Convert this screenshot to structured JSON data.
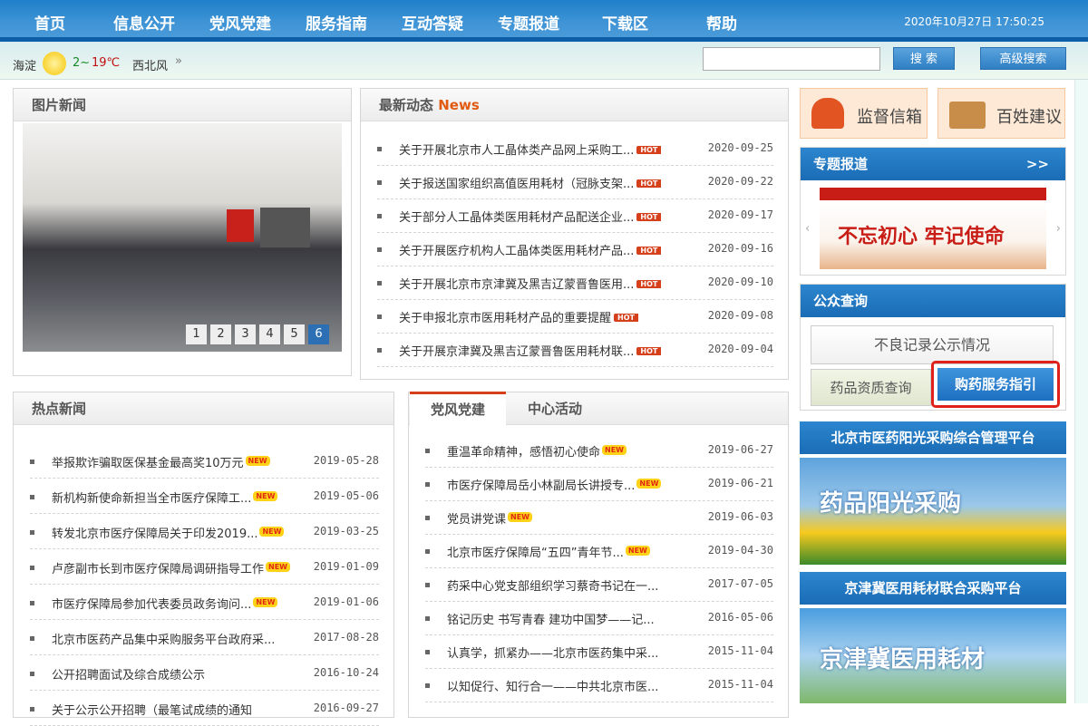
{
  "nav": {
    "items": [
      "首页",
      "信息公开",
      "党风党建",
      "服务指南",
      "互动答疑",
      "专题报道",
      "下载区",
      "帮助"
    ],
    "clock": "2020年10月27日 17:50:25"
  },
  "weather": {
    "city": "海淀",
    "temp_low": "2~",
    "temp_high": "19℃",
    "wind": "西北风",
    "more": "»"
  },
  "search": {
    "value": "",
    "button": "搜 索",
    "advanced": "高级搜索"
  },
  "photo_news": {
    "title": "图片新闻",
    "pages": [
      "1",
      "2",
      "3",
      "4",
      "5",
      "6"
    ],
    "active_page": 6
  },
  "latest": {
    "title": "最新动态",
    "title_en": "News",
    "badge": "HOT",
    "items": [
      {
        "t": "关于开展北京市人工晶体类产品网上采购工...",
        "d": "2020-09-25"
      },
      {
        "t": "关于报送国家组织高值医用耗材（冠脉支架...",
        "d": "2020-09-22"
      },
      {
        "t": "关于部分人工晶体类医用耗材产品配送企业...",
        "d": "2020-09-17"
      },
      {
        "t": "关于开展医疗机构人工晶体类医用耗材产品...",
        "d": "2020-09-16"
      },
      {
        "t": "关于开展北京市京津冀及黑吉辽蒙晋鲁医用...",
        "d": "2020-09-10"
      },
      {
        "t": "关于申报北京市医用耗材产品的重要提醒",
        "d": "2020-09-08"
      },
      {
        "t": "关于开展京津冀及黑吉辽蒙晋鲁医用耗材联...",
        "d": "2020-09-04"
      }
    ]
  },
  "hot_news": {
    "title": "热点新闻",
    "badge": "NEW",
    "items": [
      {
        "t": "举报欺诈骗取医保基金最高奖10万元",
        "d": "2019-05-28"
      },
      {
        "t": "新机构新使命新担当全市医疗保障工...",
        "d": "2019-05-06"
      },
      {
        "t": "转发北京市医疗保障局关于印发2019...",
        "d": "2019-03-25"
      },
      {
        "t": "卢彦副市长到市医疗保障局调研指导工作",
        "d": "2019-01-09"
      },
      {
        "t": "市医疗保障局参加代表委员政务询问...",
        "d": "2019-01-06"
      },
      {
        "t": "北京市医药产品集中采购服务平台政府采...",
        "d": "2017-08-28"
      },
      {
        "t": "公开招聘面试及综合成绩公示",
        "d": "2016-10-24"
      },
      {
        "t": "关于公示公开招聘（最笔试成绩的通知",
        "d": "2016-09-27"
      }
    ]
  },
  "party": {
    "tabs": [
      "党风党建",
      "中心活动"
    ],
    "badge": "NEW",
    "items": [
      {
        "t": "重温革命精神，感悟初心使命",
        "d": "2019-06-27"
      },
      {
        "t": "市医疗保障局岳小林副局长讲授专...",
        "d": "2019-06-21"
      },
      {
        "t": "党员讲党课",
        "d": "2019-06-03"
      },
      {
        "t": "北京市医疗保障局“五四”青年节...",
        "d": "2019-04-30"
      },
      {
        "t": "药采中心党支部组织学习蔡奇书记在一...",
        "d": "2017-07-05"
      },
      {
        "t": "铭记历史 书写青春 建功中国梦——记...",
        "d": "2016-05-06"
      },
      {
        "t": "认真学，抓紧办——北京市医药集中采...",
        "d": "2015-11-04"
      },
      {
        "t": "以知促行、知行合一——中共北京市医...",
        "d": "2015-11-04"
      }
    ]
  },
  "right": {
    "mailbox": "监督信箱",
    "suggest": "百姓建议",
    "special": "专题报道",
    "special_more": ">>",
    "banner_text": "不忘初心 牢记使命",
    "public_query": "公众查询",
    "bad_record": "不良记录公示情况",
    "drug_qual": "药品资质查询",
    "buy_guide": "购药服务指引",
    "platform1": "北京市医药阳光采购综合管理平台",
    "platform1_banner": "药品阳光采购",
    "platform2": "京津冀医用耗材联合采购平台",
    "platform2_banner": "京津冀医用耗材"
  }
}
